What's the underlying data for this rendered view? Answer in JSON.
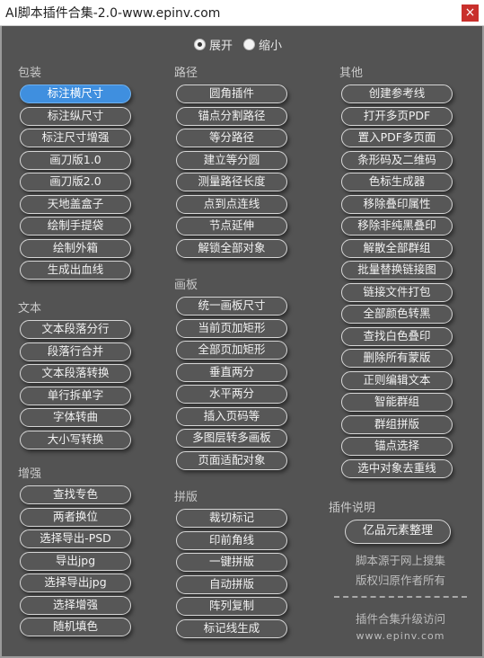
{
  "window": {
    "title": "AI脚本插件合集-2.0-www.epinv.com",
    "close_label": "×"
  },
  "mode": {
    "options": [
      "展开",
      "缩小"
    ],
    "selected": "展开"
  },
  "sections": {
    "packaging": {
      "title": "包装",
      "buttons": [
        "标注横尺寸",
        "标注纵尺寸",
        "标注尺寸增强",
        "画刀版1.0",
        "画刀版2.0",
        "天地盖盒子",
        "绘制手提袋",
        "绘制外箱",
        "生成出血线"
      ],
      "active": "标注横尺寸"
    },
    "text": {
      "title": "文本",
      "buttons": [
        "文本段落分行",
        "段落行合并",
        "文本段落转换",
        "单行拆单字",
        "字体转曲",
        "大小写转换"
      ]
    },
    "enhance": {
      "title": "增强",
      "buttons": [
        "查找专色",
        "两者换位",
        "选择导出-PSD",
        "导出jpg",
        "选择导出jpg",
        "选择增强",
        "随机填色"
      ]
    },
    "path": {
      "title": "路径",
      "buttons": [
        "圆角插件",
        "锚点分割路径",
        "等分路径",
        "建立等分圆",
        "测量路径长度",
        "点到点连线",
        "节点延伸",
        "解锁全部对象"
      ]
    },
    "artboard": {
      "title": "画板",
      "buttons": [
        "统一画板尺寸",
        "当前页加矩形",
        "全部页加矩形",
        "垂直两分",
        "水平两分",
        "插入页码等",
        "多图层转多画板",
        "页面适配对象"
      ]
    },
    "imposition": {
      "title": "拼版",
      "buttons": [
        "裁切标记",
        "印前角线",
        "一键拼版",
        "自动拼版",
        "阵列复制",
        "标记线生成"
      ]
    },
    "other": {
      "title": "其他",
      "buttons": [
        "创建参考线",
        "打开多页PDF",
        "置入PDF多页面",
        "条形码及二维码",
        "色标生成器",
        "移除叠印属性",
        "移除非纯黑叠印",
        "解散全部群组",
        "批量替换链接图",
        "链接文件打包",
        "全部颜色转黑",
        "查找白色叠印",
        "删除所有蒙版",
        "正则编辑文本",
        "智能群组",
        "群组拼版",
        "锚点选择",
        "选中对象去重线"
      ]
    },
    "plugin_info": {
      "title": "插件说明",
      "button": "亿品元素整理",
      "lines": [
        "脚本源于网上搜集",
        "版权归原作者所有"
      ],
      "upgrade_text": "插件合集升级访问",
      "site": "www.epinv.com"
    }
  }
}
